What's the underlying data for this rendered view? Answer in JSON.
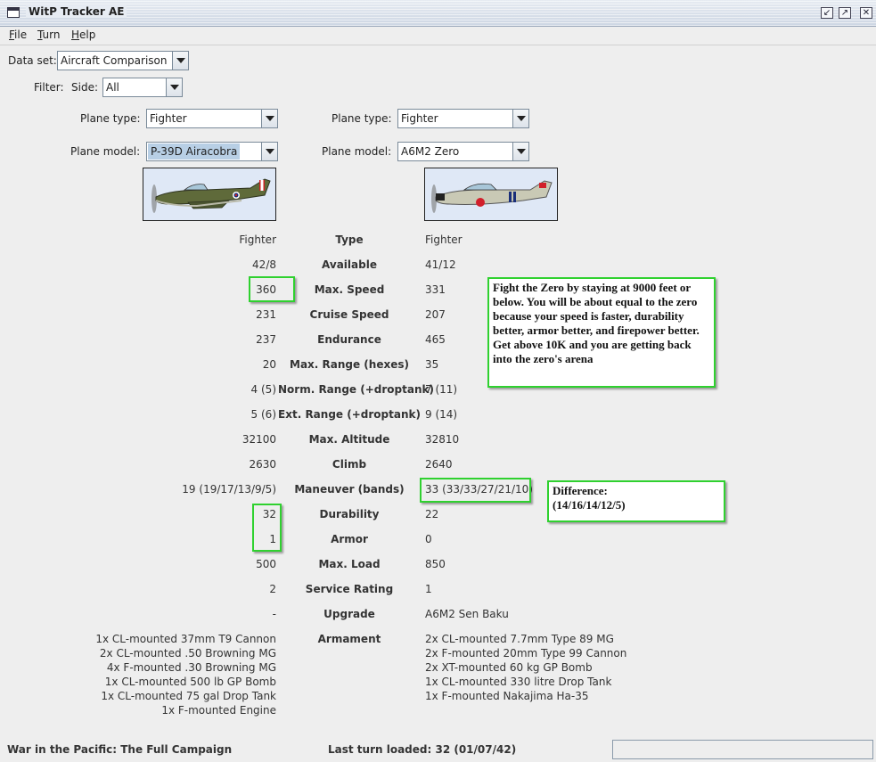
{
  "window": {
    "title": "WitP Tracker AE",
    "buttons": [
      "minimize",
      "maximize",
      "close"
    ]
  },
  "menu": {
    "items": [
      "File",
      "Turn",
      "Help"
    ]
  },
  "controls": {
    "dataset_label": "Data set:",
    "dataset_value": "Aircraft Comparison",
    "filter_label": "Filter:",
    "side_label": "Side:",
    "side_value": "All",
    "left": {
      "plane_type_label": "Plane type:",
      "plane_type_value": "Fighter",
      "plane_model_label": "Plane model:",
      "plane_model_value": "P-39D Airacobra"
    },
    "right": {
      "plane_type_label": "Plane type:",
      "plane_type_value": "Fighter",
      "plane_model_label": "Plane model:",
      "plane_model_value": "A6M2 Zero"
    }
  },
  "stats": [
    {
      "label": "Type",
      "left": "Fighter",
      "right": "Fighter"
    },
    {
      "label": "Available",
      "left": "42/8",
      "right": "41/12"
    },
    {
      "label": "Max. Speed",
      "left": "360",
      "right": "331"
    },
    {
      "label": "Cruise Speed",
      "left": "231",
      "right": "207"
    },
    {
      "label": "Endurance",
      "left": "237",
      "right": "465"
    },
    {
      "label": "Max. Range (hexes)",
      "left": "20",
      "right": "35"
    },
    {
      "label": "Norm. Range (+droptank)",
      "left": "4 (5)",
      "right": "7 (11)"
    },
    {
      "label": "Ext. Range (+droptank)",
      "left": "5 (6)",
      "right": "9 (14)"
    },
    {
      "label": "Max. Altitude",
      "left": "32100",
      "right": "32810"
    },
    {
      "label": "Climb",
      "left": "2630",
      "right": "2640"
    },
    {
      "label": "Maneuver (bands)",
      "left": "19 (19/17/13/9/5)",
      "right": "33 (33/33/27/21/10)"
    },
    {
      "label": "Durability",
      "left": "32",
      "right": "22"
    },
    {
      "label": "Armor",
      "left": "1",
      "right": "0"
    },
    {
      "label": "Max. Load",
      "left": "500",
      "right": "850"
    },
    {
      "label": "Service Rating",
      "left": "2",
      "right": "1"
    },
    {
      "label": "Upgrade",
      "left": "-",
      "right": "A6M2 Sen Baku"
    }
  ],
  "armament": {
    "label": "Armament",
    "left": [
      "1x CL-mounted 37mm T9 Cannon",
      "2x CL-mounted .50 Browning MG",
      "4x F-mounted .30 Browning MG",
      "1x CL-mounted 500 lb GP Bomb",
      "1x CL-mounted 75 gal Drop Tank",
      "1x F-mounted Engine"
    ],
    "right": [
      "2x CL-mounted 7.7mm Type 89 MG",
      "2x F-mounted 20mm Type 99 Cannon",
      "2x XT-mounted 60 kg GP Bomb",
      "1x CL-mounted 330 litre Drop Tank",
      "1x F-mounted Nakajima Ha-35"
    ]
  },
  "annotations": {
    "speed_note": "Fight the Zero by staying at 9000 feet or below. You will be about equal to the zero because your speed is faster, durability better, armor better, and firepower better. Get above 10K and you are getting back into the zero's arena",
    "difference_title": "Difference:",
    "difference_value": "(14/16/14/12/5)"
  },
  "status": {
    "campaign": "War in the Pacific: The Full Campaign",
    "last_turn": "Last turn loaded: 32 (01/07/42)"
  },
  "colors": {
    "highlight_box": "#2fd12f",
    "selection": "#b8cfe5"
  }
}
